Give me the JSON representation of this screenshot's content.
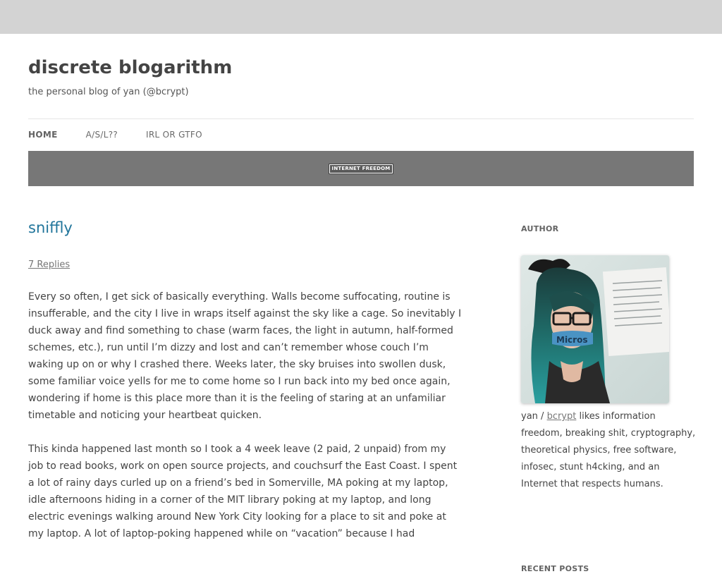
{
  "site": {
    "title": "discrete blogarithm",
    "description": "the personal blog of yan (@bcrypt)"
  },
  "nav": {
    "items": [
      {
        "label": "HOME"
      },
      {
        "label": "A/S/L??"
      },
      {
        "label": "IRL OR GTFO"
      }
    ]
  },
  "banner": {
    "badge_text": "INTERNET FREEDOM"
  },
  "post": {
    "title": "sniffly",
    "comments": "7 Replies",
    "paragraphs": [
      "Every so often, I get sick of basically everything. Walls become suffocating, routine is insufferable, and the city I live in wraps itself against the sky like a cage. So inevitably I duck away and find something to chase (warm faces, the light in autumn, half-formed schemes, etc.), run until I’m dizzy and lost and can’t remember whose couch I’m waking up on or why I crashed there. Weeks later, the sky bruises into swollen dusk, some familiar voice yells for me to come home so I run back into my bed once again, wondering if home is this place more than it is the feeling of staring at an unfamiliar timetable and noticing your heartbeat quicken.",
      "This kinda happened last month so I took a 4 week leave (2 paid, 2 unpaid) from my job to read books, work on open source projects, and couchsurf the East Coast. I spent a lot of rainy days curled up on a friend’s bed in Somerville, MA poking at my laptop, idle afternoons hiding in a corner of the MIT library poking at my laptop, and long electric evenings walking around New York City looking for a place to sit and poke at my laptop. A lot of laptop-poking happened while on “vacation” because I had"
    ]
  },
  "sidebar": {
    "author_title": "AUTHOR",
    "avatar_tape_text": "Micros",
    "author_name": "yan /",
    "author_handle": "bcrypt",
    "author_bio": " likes information freedom, breaking shit, cryptography, theoretical physics, free software, infosec, stunt h4cking, and an Internet that respects humans.",
    "recent_title": "RECENT POSTS"
  },
  "colors": {
    "top_strip": "#d3d3d3",
    "banner": "#777777",
    "link": "#21759b",
    "text": "#444444"
  }
}
